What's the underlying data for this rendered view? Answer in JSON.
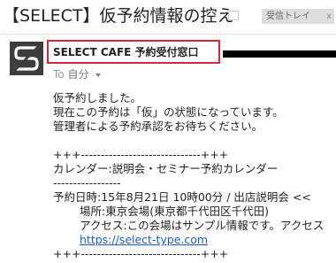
{
  "subject": {
    "title": "【SELECT】仮予約情報の控え",
    "label": "受信トレイ",
    "label_close": "x"
  },
  "sender": {
    "name": "SELECT CAFE 予約受付窓口"
  },
  "recipient": {
    "to_prefix": "To",
    "name": "自分"
  },
  "body": {
    "line1": "仮予約しました。",
    "line2": "現在この予約は「仮」の状態になっています。",
    "line3": "管理者による予約承認をお待ちください。",
    "sep1": "+++------------------------------+++",
    "calendar": "カレンダー:説明会・セミナー予約カレンダー",
    "sep_short": "-----------------",
    "datetime": "予約日時:15年8月21日 10時00分 / 出店説明会 <<",
    "location": "場所:東京会場(東京都千代田区千代田)",
    "access": "アクセス:この会場はサンプル情報です。アクセス",
    "url": "https://select-type.com",
    "sep2": "+++------------------------------+++"
  },
  "colors": {
    "highlight_border": "#d9263a",
    "link": "#1a5fc8",
    "label_bg": "#dddddd"
  }
}
